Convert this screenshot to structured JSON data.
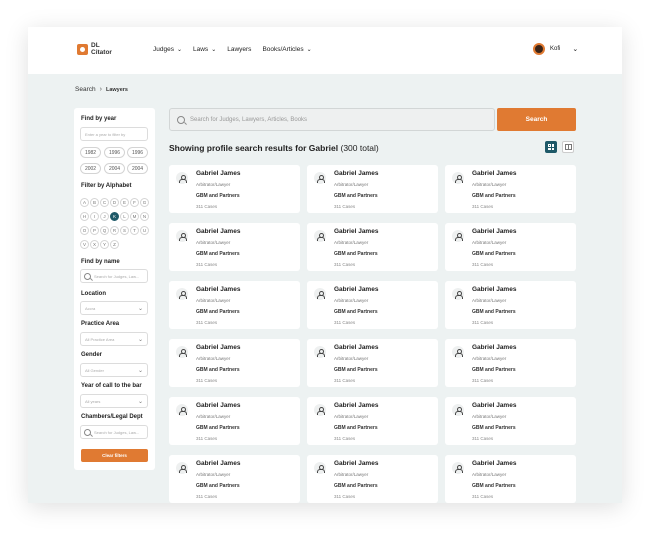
{
  "brand": {
    "name_line1": "DL",
    "name_line2": "Citator"
  },
  "nav": {
    "items": [
      {
        "label": "Judges",
        "has_dropdown": true
      },
      {
        "label": "Laws",
        "has_dropdown": true
      },
      {
        "label": "Lawyers",
        "has_dropdown": false
      },
      {
        "label": "Books/Articles",
        "has_dropdown": true
      }
    ],
    "user_name": "Kofi"
  },
  "breadcrumb": {
    "root": "Search",
    "current": "Lawyers"
  },
  "filters": {
    "year": {
      "title": "Find by year",
      "placeholder": "Enter a year to filter by",
      "years": [
        "1982",
        "1996",
        "1996",
        "2002",
        "2004",
        "2004"
      ]
    },
    "alphabet": {
      "title": "Filter by Alphabet",
      "letters": [
        "A",
        "B",
        "C",
        "D",
        "E",
        "F",
        "G",
        "H",
        "I",
        "J",
        "K",
        "L",
        "M",
        "N",
        "O",
        "P",
        "Q",
        "R",
        "S",
        "T",
        "U",
        "V",
        "X",
        "Y",
        "Z"
      ],
      "selected": "K"
    },
    "name": {
      "title": "Find by name",
      "placeholder": "Search for Judges, Law..."
    },
    "location": {
      "title": "Location",
      "value": "Accra"
    },
    "practice_area": {
      "title": "Practice Area",
      "value": "All Practice Area"
    },
    "gender": {
      "title": "Gender",
      "value": "All Gender"
    },
    "year_of_call": {
      "title": "Year of call to the bar",
      "value": "All years"
    },
    "chambers": {
      "title": "Chambers/Legal Dept",
      "placeholder": "Search for Judges, Law..."
    },
    "clear_label": "Clear filters"
  },
  "search": {
    "placeholder": "Search for Judges, Lawyers, Articles, Books",
    "button_label": "Search"
  },
  "results": {
    "heading": "Showing profile search results for Gabriel",
    "count_text": "(300 total)",
    "view_mode": "grid",
    "profiles": [
      {
        "name": "Gabriel James",
        "role": "Arbitrator/Lawyer",
        "firm": "GBM and Partners",
        "cases": "311 Cases"
      },
      {
        "name": "Gabriel James",
        "role": "Arbitrator/Lawyer",
        "firm": "GBM and Partners",
        "cases": "311 Cases"
      },
      {
        "name": "Gabriel James",
        "role": "Arbitrator/Lawyer",
        "firm": "GBM and Partners",
        "cases": "311 Cases"
      },
      {
        "name": "Gabriel James",
        "role": "Arbitrator/Lawyer",
        "firm": "GBM and Partners",
        "cases": "311 Cases"
      },
      {
        "name": "Gabriel James",
        "role": "Arbitrator/Lawyer",
        "firm": "GBM and Partners",
        "cases": "311 Cases"
      },
      {
        "name": "Gabriel James",
        "role": "Arbitrator/Lawyer",
        "firm": "GBM and Partners",
        "cases": "311 Cases"
      },
      {
        "name": "Gabriel James",
        "role": "Arbitrator/Lawyer",
        "firm": "GBM and Partners",
        "cases": "311 Cases"
      },
      {
        "name": "Gabriel James",
        "role": "Arbitrator/Lawyer",
        "firm": "GBM and Partners",
        "cases": "311 Cases"
      },
      {
        "name": "Gabriel James",
        "role": "Arbitrator/Lawyer",
        "firm": "GBM and Partners",
        "cases": "311 Cases"
      },
      {
        "name": "Gabriel James",
        "role": "Arbitrator/Lawyer",
        "firm": "GBM and Partners",
        "cases": "311 Cases"
      },
      {
        "name": "Gabriel James",
        "role": "Arbitrator/Lawyer",
        "firm": "GBM and Partners",
        "cases": "311 Cases"
      },
      {
        "name": "Gabriel James",
        "role": "Arbitrator/Lawyer",
        "firm": "GBM and Partners",
        "cases": "311 Cases"
      },
      {
        "name": "Gabriel James",
        "role": "Arbitrator/Lawyer",
        "firm": "GBM and Partners",
        "cases": "311 Cases"
      },
      {
        "name": "Gabriel James",
        "role": "Arbitrator/Lawyer",
        "firm": "GBM and Partners",
        "cases": "311 Cases"
      },
      {
        "name": "Gabriel James",
        "role": "Arbitrator/Lawyer",
        "firm": "GBM and Partners",
        "cases": "311 Cases"
      },
      {
        "name": "Gabriel James",
        "role": "Arbitrator/Lawyer",
        "firm": "GBM and Partners",
        "cases": "311 Cases"
      },
      {
        "name": "Gabriel James",
        "role": "Arbitrator/Lawyer",
        "firm": "GBM and Partners",
        "cases": "311 Cases"
      },
      {
        "name": "Gabriel James",
        "role": "Arbitrator/Lawyer",
        "firm": "GBM and Partners",
        "cases": "311 Cases"
      }
    ]
  },
  "colors": {
    "accent": "#e07a32",
    "teal": "#1e5968",
    "background": "#edf2f2"
  }
}
